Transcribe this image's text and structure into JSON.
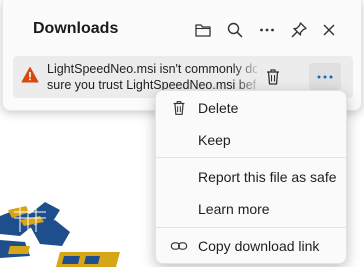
{
  "flyout": {
    "title": "Downloads",
    "item": {
      "line1": "LightSpeedNeo.msi isn't commonly do",
      "line2": "sure you trust LightSpeedNeo.msi bef"
    }
  },
  "menu": {
    "items": [
      {
        "label": "Delete",
        "icon": "trash-icon"
      },
      {
        "label": "Keep",
        "icon": ""
      },
      {
        "label": "Report this file as safe",
        "icon": ""
      },
      {
        "label": "Learn more",
        "icon": ""
      },
      {
        "label": "Copy download link",
        "icon": "link-icon"
      }
    ]
  },
  "colors": {
    "warning": "#d9480f",
    "accent": "#0f6cbd",
    "logo_blue": "#1e4f8c",
    "logo_gold": "#d6a617"
  }
}
